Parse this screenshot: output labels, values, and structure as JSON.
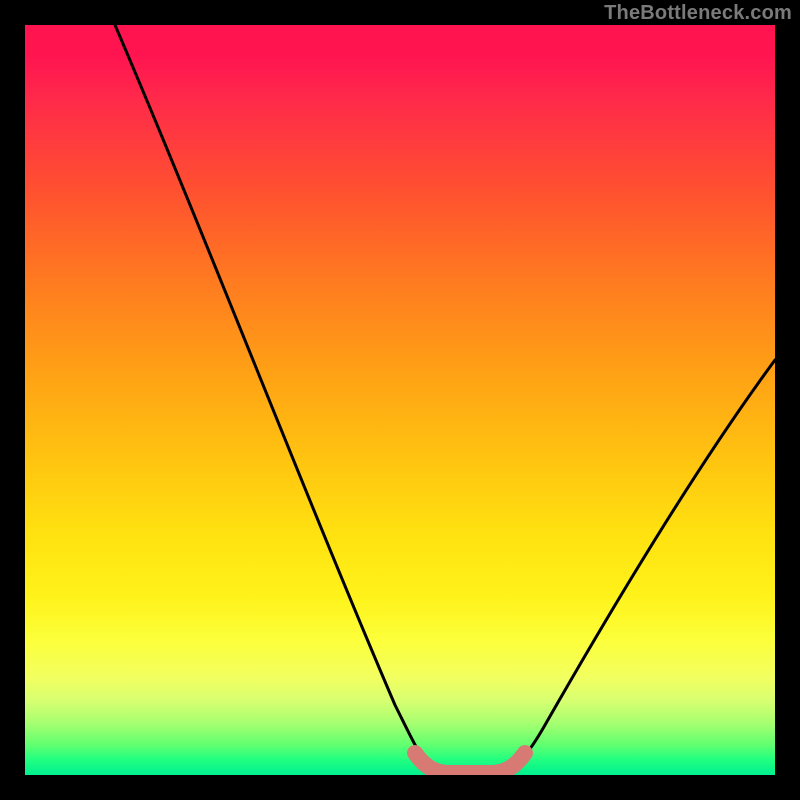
{
  "watermark": "TheBottleneck.com",
  "chart_data": {
    "type": "line",
    "title": "",
    "xlabel": "",
    "ylabel": "",
    "xlim": [
      0,
      100
    ],
    "ylim": [
      0,
      100
    ],
    "series": [
      {
        "name": "bottleneck-curve",
        "x": [
          12,
          16,
          20,
          24,
          28,
          32,
          36,
          40,
          44,
          48,
          50,
          52,
          55,
          57,
          60,
          64,
          68,
          72,
          76,
          80,
          84,
          88,
          92,
          96,
          100
        ],
        "y": [
          100,
          91,
          82,
          73,
          64,
          55,
          46,
          37,
          28,
          19,
          10,
          4,
          1,
          0,
          0,
          1,
          3,
          8,
          15,
          22,
          29,
          36,
          43,
          49,
          55
        ]
      },
      {
        "name": "optimal-band",
        "x": [
          52,
          54,
          55,
          57,
          59,
          61,
          63,
          64
        ],
        "y": [
          3,
          1.5,
          0.8,
          0.5,
          0.5,
          0.8,
          1.5,
          3
        ]
      }
    ],
    "optimal_range_x": [
      52,
      64
    ],
    "colors": {
      "curve": "#000000",
      "optimal_band": "#d77a74",
      "gradient_top": "#ff1450",
      "gradient_bottom": "#00f090"
    }
  }
}
